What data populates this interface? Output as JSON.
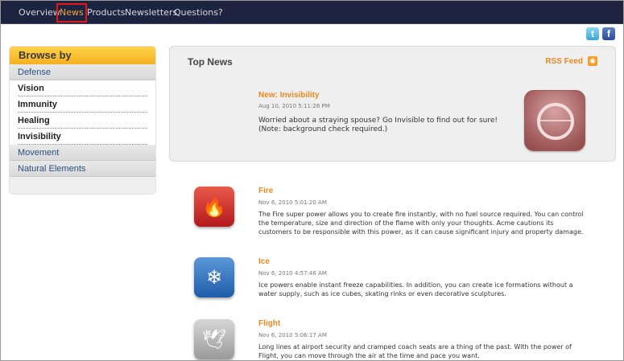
{
  "nav": {
    "items": [
      {
        "label": "Overview",
        "active": false
      },
      {
        "label": "News",
        "active": true
      },
      {
        "label": "Products",
        "active": false
      },
      {
        "label": "Newsletters",
        "active": false
      },
      {
        "label": "Questions?",
        "active": false
      }
    ],
    "accent": "#f2a93a",
    "highlight_color": "#e01818"
  },
  "social": {
    "twitter_glyph": "t",
    "facebook_glyph": "f"
  },
  "sidebar": {
    "title": "Browse by",
    "items": [
      {
        "label": "Defense",
        "type": "category"
      },
      {
        "label": "Vision",
        "type": "sub"
      },
      {
        "label": "Immunity",
        "type": "sub"
      },
      {
        "label": "Healing",
        "type": "sub"
      },
      {
        "label": "Invisibility",
        "type": "sub"
      },
      {
        "label": "Movement",
        "type": "category"
      },
      {
        "label": "Natural Elements",
        "type": "category"
      }
    ]
  },
  "top_news": {
    "title": "Top News",
    "rss_label": "RSS Feed",
    "rss_icon": "rss-icon",
    "headline": "New: Invisibility",
    "date": "Aug 10, 2010 5:11:26 PM",
    "body": "Worried about a straying spouse? Go Invisible to find out for sure! (Note: background check required.)",
    "image_icon": "invisibility-icon"
  },
  "news": [
    {
      "title": "Fire",
      "date": "Nov 6, 2010 5:01:20 AM",
      "body": "The Fire super power allows you to create fire instantly, with no fuel source required. You can control the temperature, size and direction of the flame with only your thoughts. Acme cautions its customers to be responsible with this power, as it can cause significant injury and property damage.",
      "icon": "fire-icon",
      "glyph": "🔥"
    },
    {
      "title": "Ice",
      "date": "Nov 6, 2010 4:57:46 AM",
      "body": "Ice powers enable instant freeze capabilities. In addition, you can create ice formations without a water supply, such as ice cubes, skating rinks or even decorative sculptures.",
      "icon": "snowflake-icon",
      "glyph": "❄"
    },
    {
      "title": "Flight",
      "date": "Nov 6, 2010 5:06:17 AM",
      "body": "Long lines at airport security and cramped coach seats are a thing of the past. With the power of Flight, you can move through the air at the time and pace you want.",
      "icon": "bird-icon",
      "glyph": "🕊"
    }
  ]
}
